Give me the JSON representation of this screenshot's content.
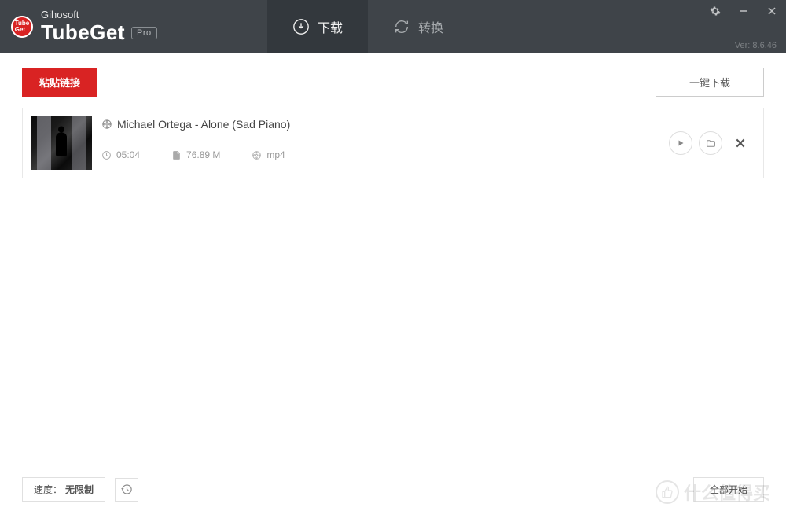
{
  "header": {
    "company": "Gihosoft",
    "product": "TubeGet",
    "badge": "Pro",
    "version": "Ver: 8.6.46"
  },
  "tabs": {
    "download": "下载",
    "convert": "转换"
  },
  "toolbar": {
    "paste": "粘贴链接",
    "quick": "一键下载"
  },
  "items": [
    {
      "title": "Michael Ortega - Alone (Sad Piano)",
      "duration": "05:04",
      "size": "76.89 M",
      "format": "mp4"
    }
  ],
  "footer": {
    "speed_label": "速度：",
    "speed_value": "无限制",
    "start_all": "全部开始"
  },
  "watermark": "什么值得买"
}
